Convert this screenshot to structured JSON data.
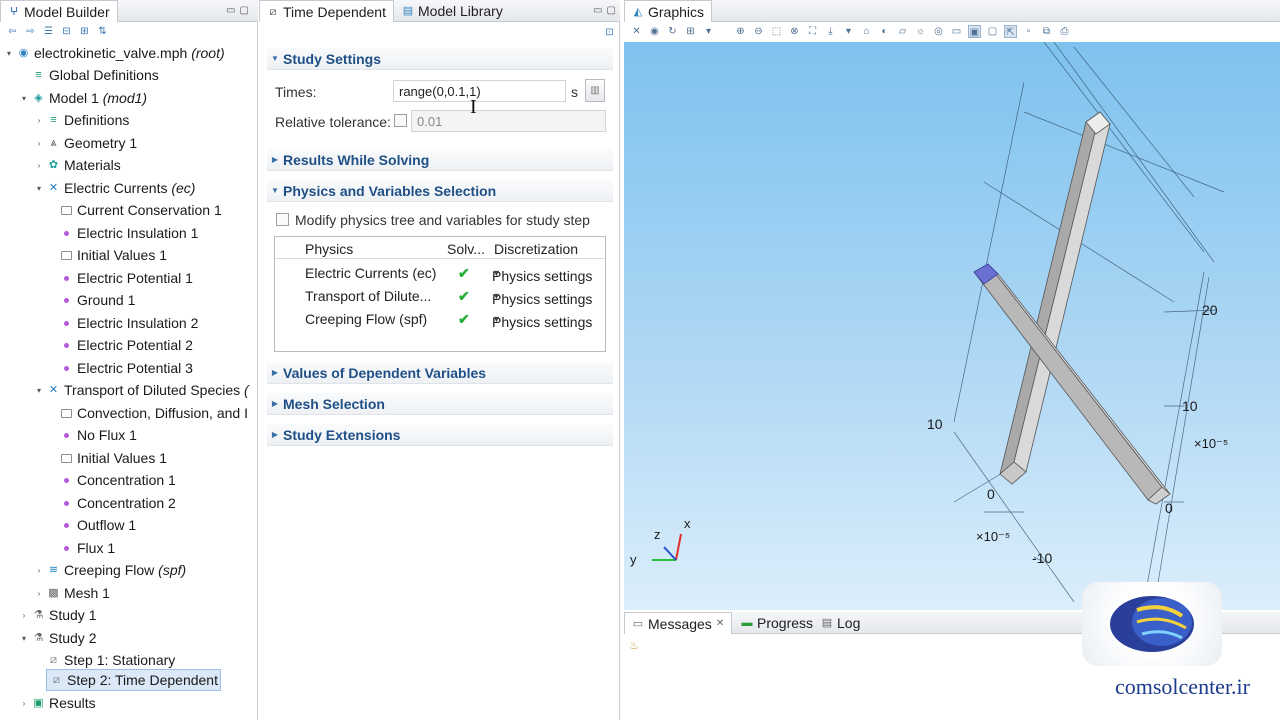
{
  "builder": {
    "title": "Model Builder",
    "tree": [
      {
        "label": "electrokinetic_valve.mph",
        "suffix": "(root)",
        "level": 0,
        "icon": "file-icon",
        "toggle": "▾"
      },
      {
        "label": "Global Definitions",
        "suffix": "",
        "level": 1,
        "icon": "global-definitions-icon",
        "toggle": ""
      },
      {
        "label": "Model 1",
        "suffix": "(mod1)",
        "level": 1,
        "icon": "model-icon",
        "toggle": "▾"
      },
      {
        "label": "Definitions",
        "suffix": "",
        "level": 2,
        "icon": "definitions-icon",
        "toggle": "›"
      },
      {
        "label": "Geometry 1",
        "suffix": "",
        "level": 2,
        "icon": "geometry-icon",
        "toggle": "›"
      },
      {
        "label": "Materials",
        "suffix": "",
        "level": 2,
        "icon": "materials-icon",
        "toggle": "›"
      },
      {
        "label": "Electric Currents",
        "suffix": "(ec)",
        "level": 2,
        "icon": "physics-icon",
        "toggle": "▾"
      },
      {
        "label": "Current Conservation 1",
        "suffix": "",
        "level": 3,
        "icon": "feature-icon",
        "toggle": ""
      },
      {
        "label": "Electric Insulation 1",
        "suffix": "",
        "level": 3,
        "icon": "boundary-icon",
        "toggle": ""
      },
      {
        "label": "Initial Values 1",
        "suffix": "",
        "level": 3,
        "icon": "feature-icon",
        "toggle": ""
      },
      {
        "label": "Electric Potential 1",
        "suffix": "",
        "level": 3,
        "icon": "boundary-icon",
        "toggle": ""
      },
      {
        "label": "Ground 1",
        "suffix": "",
        "level": 3,
        "icon": "boundary-icon",
        "toggle": ""
      },
      {
        "label": "Electric Insulation 2",
        "suffix": "",
        "level": 3,
        "icon": "boundary-icon",
        "toggle": ""
      },
      {
        "label": "Electric Potential 2",
        "suffix": "",
        "level": 3,
        "icon": "boundary-icon",
        "toggle": ""
      },
      {
        "label": "Electric Potential 3",
        "suffix": "",
        "level": 3,
        "icon": "boundary-icon",
        "toggle": ""
      },
      {
        "label": "Transport of Diluted Species",
        "suffix": "(",
        "level": 2,
        "icon": "physics-icon",
        "toggle": "▾"
      },
      {
        "label": "Convection, Diffusion, and I",
        "suffix": "",
        "level": 3,
        "icon": "feature-icon",
        "toggle": ""
      },
      {
        "label": "No Flux 1",
        "suffix": "",
        "level": 3,
        "icon": "boundary-icon",
        "toggle": ""
      },
      {
        "label": "Initial Values 1",
        "suffix": "",
        "level": 3,
        "icon": "feature-icon",
        "toggle": ""
      },
      {
        "label": "Concentration 1",
        "suffix": "",
        "level": 3,
        "icon": "boundary-icon",
        "toggle": ""
      },
      {
        "label": "Concentration 2",
        "suffix": "",
        "level": 3,
        "icon": "boundary-icon",
        "toggle": ""
      },
      {
        "label": "Outflow 1",
        "suffix": "",
        "level": 3,
        "icon": "boundary-icon",
        "toggle": ""
      },
      {
        "label": "Flux 1",
        "suffix": "",
        "level": 3,
        "icon": "boundary-icon",
        "toggle": ""
      },
      {
        "label": "Creeping Flow",
        "suffix": "(spf)",
        "level": 2,
        "icon": "flow-icon",
        "toggle": "›"
      },
      {
        "label": "Mesh 1",
        "suffix": "",
        "level": 2,
        "icon": "mesh-icon",
        "toggle": "›"
      },
      {
        "label": "Study 1",
        "suffix": "",
        "level": 1,
        "icon": "study-icon",
        "toggle": "›"
      },
      {
        "label": "Study 2",
        "suffix": "",
        "level": 1,
        "icon": "study-icon",
        "toggle": "▾"
      },
      {
        "label": "Step 1: Stationary",
        "suffix": "",
        "level": 2,
        "icon": "step-icon",
        "toggle": ""
      },
      {
        "label": "Step 2: Time Dependent",
        "suffix": "",
        "level": 2,
        "icon": "step-icon",
        "toggle": "",
        "selected": true
      },
      {
        "label": "Results",
        "suffix": "",
        "level": 1,
        "icon": "results-icon",
        "toggle": "›"
      }
    ]
  },
  "settings": {
    "tabs": [
      {
        "label": "Time Dependent"
      },
      {
        "label": "Model Library"
      }
    ],
    "study_settings": {
      "title": "Study Settings",
      "times_label": "Times:",
      "times_value": "range(0,0.1,1)",
      "times_unit": "s",
      "tolerance_label": "Relative tolerance:",
      "tolerance_value": "0.01"
    },
    "sections": {
      "results_while_solving": "Results While Solving",
      "physics_selection": "Physics and Variables Selection",
      "values_dependent": "Values of Dependent Variables",
      "mesh_selection": "Mesh Selection",
      "study_extensions": "Study Extensions"
    },
    "modify_label": "Modify physics tree and variables for study step",
    "table": {
      "headers": [
        "Physics",
        "Solv...",
        "Discretization"
      ],
      "rows": [
        {
          "physics": "Electric Currents (ec)",
          "solve": "✔",
          "discretization": "Physics settings"
        },
        {
          "physics": "Transport of Dilute...",
          "solve": "✔",
          "discretization": "Physics settings"
        },
        {
          "physics": "Creeping Flow (spf)",
          "solve": "✔",
          "discretization": "Physics settings"
        }
      ]
    }
  },
  "graphics": {
    "title": "Graphics",
    "axis_labels": {
      "right_top": "20",
      "right_mid": "10",
      "right_exp": "×10⁻⁵",
      "right_zero": "0",
      "left_ten": "10",
      "bottom_zero": "0",
      "bottom_exp": "×10⁻⁵",
      "bottom_neg": "-10"
    },
    "triad": {
      "x": "x",
      "y": "y",
      "z": "z"
    }
  },
  "messages": {
    "tabs": [
      {
        "label": "Messages"
      },
      {
        "label": "Progress"
      },
      {
        "label": "Log"
      }
    ],
    "watermark": "comsolcenter.ir"
  }
}
